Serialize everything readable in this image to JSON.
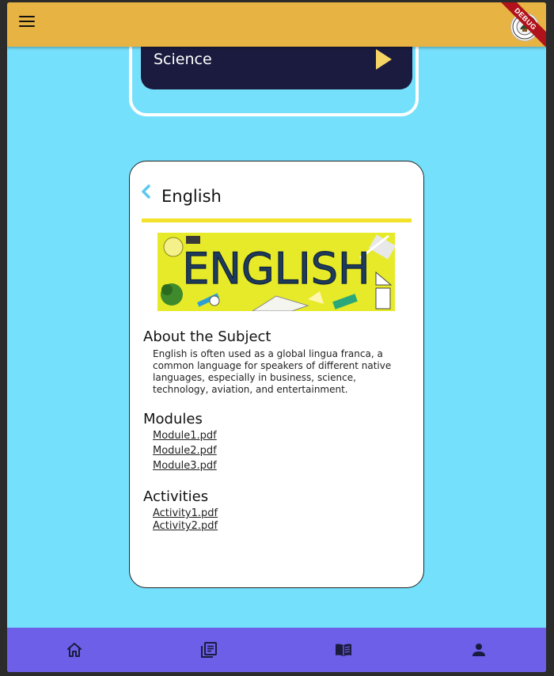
{
  "science": {
    "label": "Science"
  },
  "subject": {
    "title": "English",
    "banner_text": "ENGLISH",
    "about_heading": "About the Subject",
    "about_text": "English is often used as a global lingua franca, a common language for speakers of different native languages, especially in business, science, technology, aviation, and entertainment.",
    "modules_heading": "Modules",
    "modules": [
      "Module1.pdf",
      "Module2.pdf",
      "Module3.pdf"
    ],
    "activities_heading": "Activities",
    "activities": [
      "Activity1.pdf",
      "Activity2.pdf"
    ]
  },
  "debug_badge": "DEBUG",
  "bottom_nav": {
    "items": [
      {
        "icon": "home-icon"
      },
      {
        "icon": "library-books-icon"
      },
      {
        "icon": "menu-book-icon"
      },
      {
        "icon": "person-icon"
      }
    ]
  },
  "colors": {
    "app_background": "#75e0fb",
    "app_bar": "#e7b342",
    "bottom_nav": "#6d5fe7",
    "science_button": "#1b1b3f",
    "divider": "#f4e22a"
  }
}
